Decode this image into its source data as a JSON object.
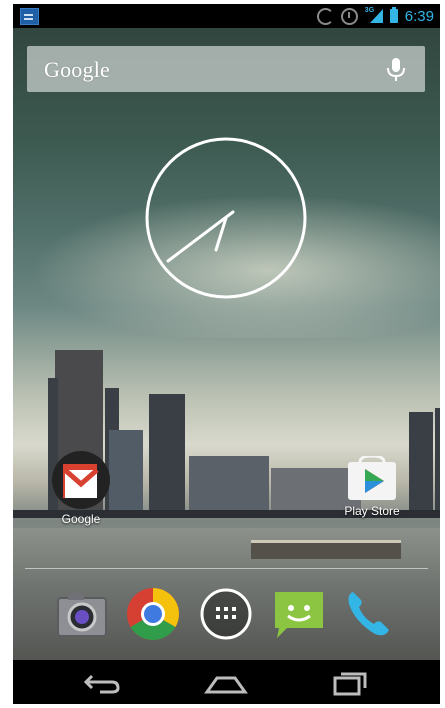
{
  "status_bar": {
    "time": "6:39",
    "network_type": "3G",
    "icons": [
      "notification-icon",
      "sync-icon",
      "alarm-icon",
      "signal-icon",
      "battery-icon"
    ]
  },
  "search_widget": {
    "logo_text": "Google",
    "mic_icon": "microphone-icon"
  },
  "clock_widget": {
    "type": "analog"
  },
  "home_shortcuts": [
    {
      "label": "Google",
      "icon": "gmail-icon"
    },
    {
      "label": "Play Store",
      "icon": "play-store-icon"
    }
  ],
  "dock": [
    {
      "name": "Camera",
      "icon": "camera-icon"
    },
    {
      "name": "Chrome",
      "icon": "chrome-icon"
    },
    {
      "name": "All apps",
      "icon": "app-drawer-icon"
    },
    {
      "name": "Messaging",
      "icon": "messaging-icon"
    },
    {
      "name": "Phone",
      "icon": "phone-icon"
    }
  ],
  "nav_bar": {
    "buttons": [
      "back-icon",
      "home-icon",
      "recent-apps-icon"
    ]
  },
  "colors": {
    "accent": "#33b5e5",
    "status_bar_bg": "#000000",
    "nav_bar_bg": "#000000"
  }
}
